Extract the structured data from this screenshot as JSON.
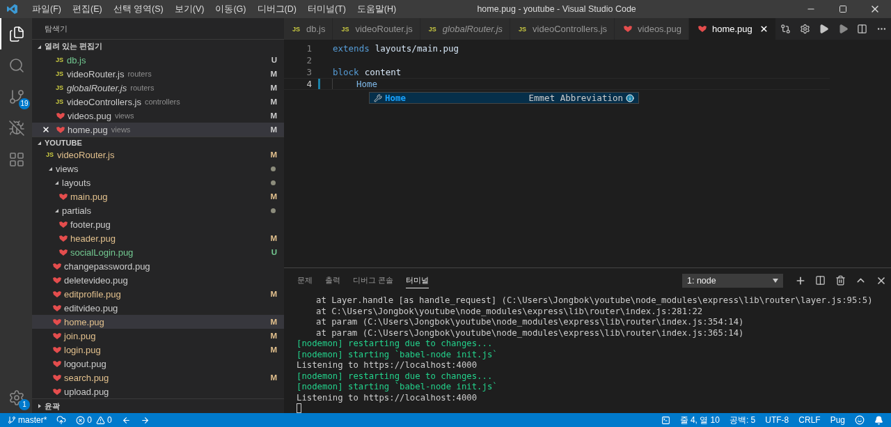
{
  "title_bar": {
    "menu": [
      "파일(F)",
      "편집(E)",
      "선택 영역(S)",
      "보기(V)",
      "이동(G)",
      "디버그(D)",
      "터미널(T)",
      "도움말(H)"
    ],
    "title": "home.pug - youtube - Visual Studio Code"
  },
  "activity_bar": {
    "items": [
      {
        "kind": "explorer",
        "selected": true
      },
      {
        "kind": "search",
        "selected": false
      },
      {
        "kind": "source_control",
        "selected": false,
        "badge": "19"
      },
      {
        "kind": "debug",
        "selected": false
      },
      {
        "kind": "extensions",
        "selected": false
      }
    ],
    "manage": {
      "badge": "1"
    }
  },
  "sidebar": {
    "title": "탐색기",
    "open_editors": {
      "title": "열려 있는 편집기",
      "expanded": true,
      "items": [
        {
          "name": "db.js",
          "kind": "js",
          "icon_text": "JS",
          "untracked": true,
          "badge": "U",
          "italic": false,
          "selected": false
        },
        {
          "name": "videoRouter.js",
          "kind": "js",
          "icon_text": "JS",
          "description": "routers",
          "untracked": false,
          "badge": "M",
          "italic": false,
          "selected": false
        },
        {
          "name": "globalRouter.js",
          "kind": "js",
          "icon_text": "JS",
          "description": "routers",
          "untracked": false,
          "badge": "M",
          "italic": true,
          "selected": false
        },
        {
          "name": "videoControllers.js",
          "kind": "js",
          "icon_text": "JS",
          "description": "controllers",
          "untracked": false,
          "badge": "M",
          "italic": false,
          "selected": false
        },
        {
          "name": "videos.pug",
          "kind": "pug",
          "description": "views",
          "untracked": false,
          "badge": "M",
          "italic": false,
          "selected": false
        },
        {
          "name": "home.pug",
          "kind": "pug",
          "description": "views",
          "untracked": false,
          "badge": "M",
          "italic": false,
          "selected": true
        }
      ]
    },
    "folder": {
      "title": "YOUTUBE",
      "expanded": true,
      "items": [
        {
          "name": "videoRouter.js",
          "kind": "js",
          "icon_text": "JS",
          "modified": true,
          "untracked": false,
          "badge": "M",
          "selected": false
        },
        {
          "name": "views",
          "kind": "folder",
          "has_changes": true,
          "expanded": true,
          "selected": false,
          "children": [
            {
              "name": "layouts",
              "kind": "folder",
              "has_changes": true,
              "expanded": true,
              "selected": false,
              "children": [
                {
                  "name": "main.pug",
                  "kind": "pug",
                  "modified": true,
                  "untracked": false,
                  "badge": "M",
                  "selected": false
                }
              ]
            },
            {
              "name": "partials",
              "kind": "folder",
              "has_changes": true,
              "expanded": true,
              "selected": false,
              "children": [
                {
                  "name": "footer.pug",
                  "kind": "pug",
                  "modified": false,
                  "untracked": false,
                  "selected": false
                },
                {
                  "name": "header.pug",
                  "kind": "pug",
                  "modified": true,
                  "untracked": false,
                  "badge": "M",
                  "selected": false
                },
                {
                  "name": "socialLogin.pug",
                  "kind": "pug",
                  "untracked": true,
                  "badge": "U",
                  "selected": false
                }
              ]
            },
            {
              "name": "changepassword.pug",
              "kind": "pug",
              "modified": false,
              "untracked": false,
              "selected": false
            },
            {
              "name": "deletevideo.pug",
              "kind": "pug",
              "modified": false,
              "untracked": false,
              "selected": false
            },
            {
              "name": "editprofile.pug",
              "kind": "pug",
              "modified": true,
              "untracked": false,
              "badge": "M",
              "selected": false
            },
            {
              "name": "editvideo.pug",
              "kind": "pug",
              "modified": false,
              "untracked": false,
              "selected": false
            },
            {
              "name": "home.pug",
              "kind": "pug",
              "modified": true,
              "untracked": false,
              "badge": "M",
              "selected": true
            },
            {
              "name": "join.pug",
              "kind": "pug",
              "modified": true,
              "untracked": false,
              "badge": "M",
              "selected": false
            },
            {
              "name": "login.pug",
              "kind": "pug",
              "modified": true,
              "untracked": false,
              "badge": "M",
              "selected": false
            },
            {
              "name": "logout.pug",
              "kind": "pug",
              "modified": false,
              "untracked": false,
              "selected": false
            },
            {
              "name": "search.pug",
              "kind": "pug",
              "modified": true,
              "untracked": false,
              "badge": "M",
              "selected": false
            },
            {
              "name": "upload.pug",
              "kind": "pug",
              "modified": false,
              "untracked": false,
              "selected": false
            }
          ]
        }
      ]
    },
    "outline": {
      "title": "윤곽",
      "expanded": false
    }
  },
  "editor": {
    "tabs": [
      {
        "name": "db.js",
        "kind": "js",
        "icon_text": "JS",
        "italic": false,
        "selected": false
      },
      {
        "name": "videoRouter.js",
        "kind": "js",
        "icon_text": "JS",
        "italic": false,
        "selected": false
      },
      {
        "name": "globalRouter.js",
        "kind": "js",
        "icon_text": "JS",
        "italic": true,
        "selected": false
      },
      {
        "name": "videoControllers.js",
        "kind": "js",
        "icon_text": "JS",
        "italic": false,
        "selected": false
      },
      {
        "name": "videos.pug",
        "kind": "pug",
        "italic": false,
        "selected": false
      },
      {
        "name": "home.pug",
        "kind": "pug",
        "italic": false,
        "selected": true
      }
    ],
    "lines": [
      {
        "number": "1",
        "current": false,
        "indented": false,
        "tokens": [
          {
            "kind": "keyword",
            "text": "extends"
          },
          {
            "kind": "value",
            "text": "layouts/main.pug"
          }
        ]
      },
      {
        "number": "2",
        "current": false,
        "indented": false
      },
      {
        "number": "3",
        "current": false,
        "indented": false,
        "tokens": [
          {
            "kind": "keyword",
            "text": "block"
          },
          {
            "kind": "value",
            "text": "content"
          }
        ]
      },
      {
        "number": "4",
        "current": true,
        "indented": true,
        "tokens": [
          {
            "kind": "tag",
            "text": "Home"
          }
        ]
      }
    ],
    "suggestion": {
      "label": "Home",
      "detail": "Emmet Abbreviation"
    }
  },
  "panel": {
    "tabs": [
      {
        "label": "문제",
        "selected": false
      },
      {
        "label": "출력",
        "selected": false
      },
      {
        "label": "디버그 콘솔",
        "selected": false
      },
      {
        "label": "터미널",
        "selected": true
      }
    ],
    "terminal_select": "1: node",
    "lines": [
      {
        "kind": "stack",
        "text": "at Layer.handle [as handle_request] (C:\\Users\\Jongbok\\youtube\\node_modules\\express\\lib\\router\\layer.js:95:5)"
      },
      {
        "kind": "stack",
        "text": "at C:\\Users\\Jongbok\\youtube\\node_modules\\express\\lib\\router\\index.js:281:22"
      },
      {
        "kind": "stack",
        "text": "at param (C:\\Users\\Jongbok\\youtube\\node_modules\\express\\lib\\router\\index.js:354:14)"
      },
      {
        "kind": "stack",
        "text": "at param (C:\\Users\\Jongbok\\youtube\\node_modules\\express\\lib\\router\\index.js:365:14)"
      },
      {
        "kind": "nodemon",
        "text": "[nodemon] restarting due to changes..."
      },
      {
        "kind": "nodemon",
        "text": "[nodemon] starting `babel-node init.js`"
      },
      {
        "kind": "plain",
        "text": "Listening to https://localhost:4000"
      },
      {
        "kind": "nodemon",
        "text": "[nodemon] restarting due to changes..."
      },
      {
        "kind": "nodemon",
        "text": "[nodemon] starting `babel-node init.js`"
      },
      {
        "kind": "plain",
        "text": "Listening to https://localhost:4000"
      }
    ]
  },
  "status_bar": {
    "branch": "master*",
    "errors": "0",
    "warnings": "0",
    "position": "줄 4, 열 10",
    "indent": "공백: 5",
    "encoding": "UTF-8",
    "eol": "CRLF",
    "language": "Pug"
  }
}
